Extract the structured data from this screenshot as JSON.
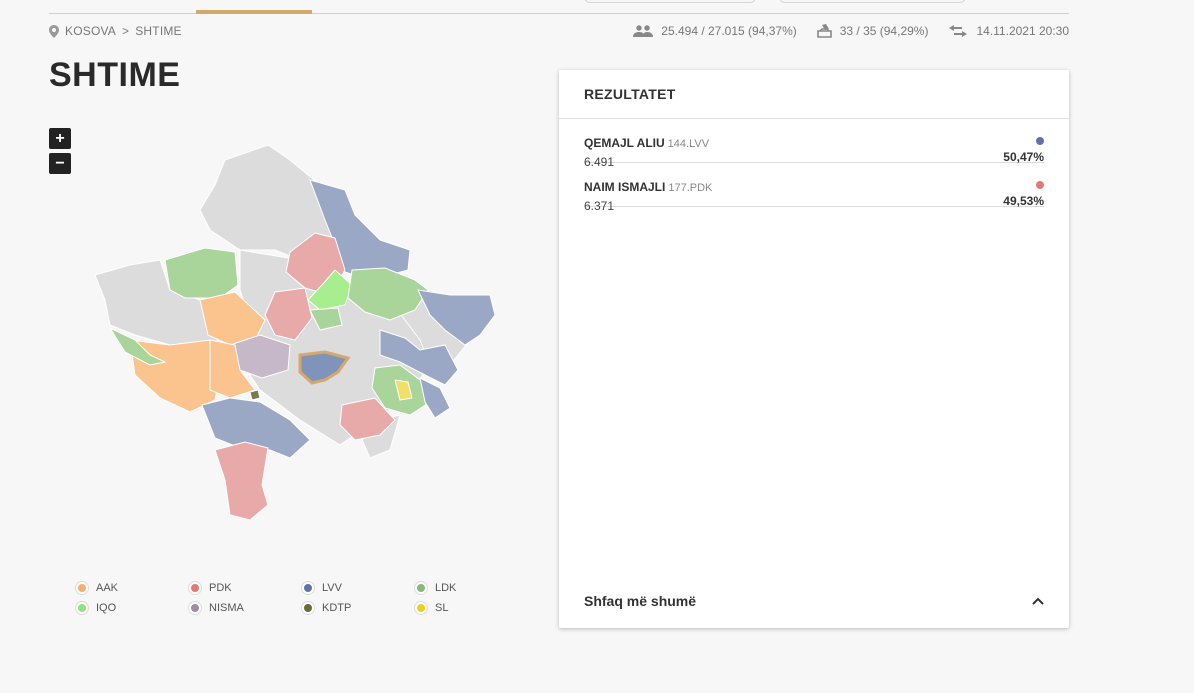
{
  "breadcrumb": {
    "country": "KOSOVA",
    "separator": ">",
    "municipality": "SHTIME"
  },
  "stats": {
    "turnout": "25.494 / 27.015 (94,37%)",
    "stations": "33 / 35 (94,29%)",
    "updated": "14.11.2021 20:30"
  },
  "page": {
    "title": "SHTIME"
  },
  "map": {
    "zoom_in": "+",
    "zoom_out": "−"
  },
  "legend": [
    {
      "label": "AAK",
      "color": "#f9ad6a"
    },
    {
      "label": "PDK",
      "color": "#e07a78"
    },
    {
      "label": "LVV",
      "color": "#5f73a8"
    },
    {
      "label": "LDK",
      "color": "#84b97a"
    },
    {
      "label": "IQO",
      "color": "#8fe57a"
    },
    {
      "label": "NISMA",
      "color": "#a08ba8"
    },
    {
      "label": "KDTP",
      "color": "#6b6b3a"
    },
    {
      "label": "SL",
      "color": "#e8d21b"
    }
  ],
  "results": {
    "title": "REZULTATET",
    "candidates": [
      {
        "name": "QEMAJL ALIU",
        "party": "144.LVV",
        "votes": "6.491",
        "percent": "50,47%",
        "color": "#5f73a8"
      },
      {
        "name": "NAIM ISMAJLI",
        "party": "177.PDK",
        "votes": "6.371",
        "percent": "49,53%",
        "color": "#e07a78"
      }
    ],
    "show_more": "Shfaq më shumë"
  },
  "colors": {
    "accent": "#d6a86a",
    "neutral_region": "#dcdcdc"
  }
}
